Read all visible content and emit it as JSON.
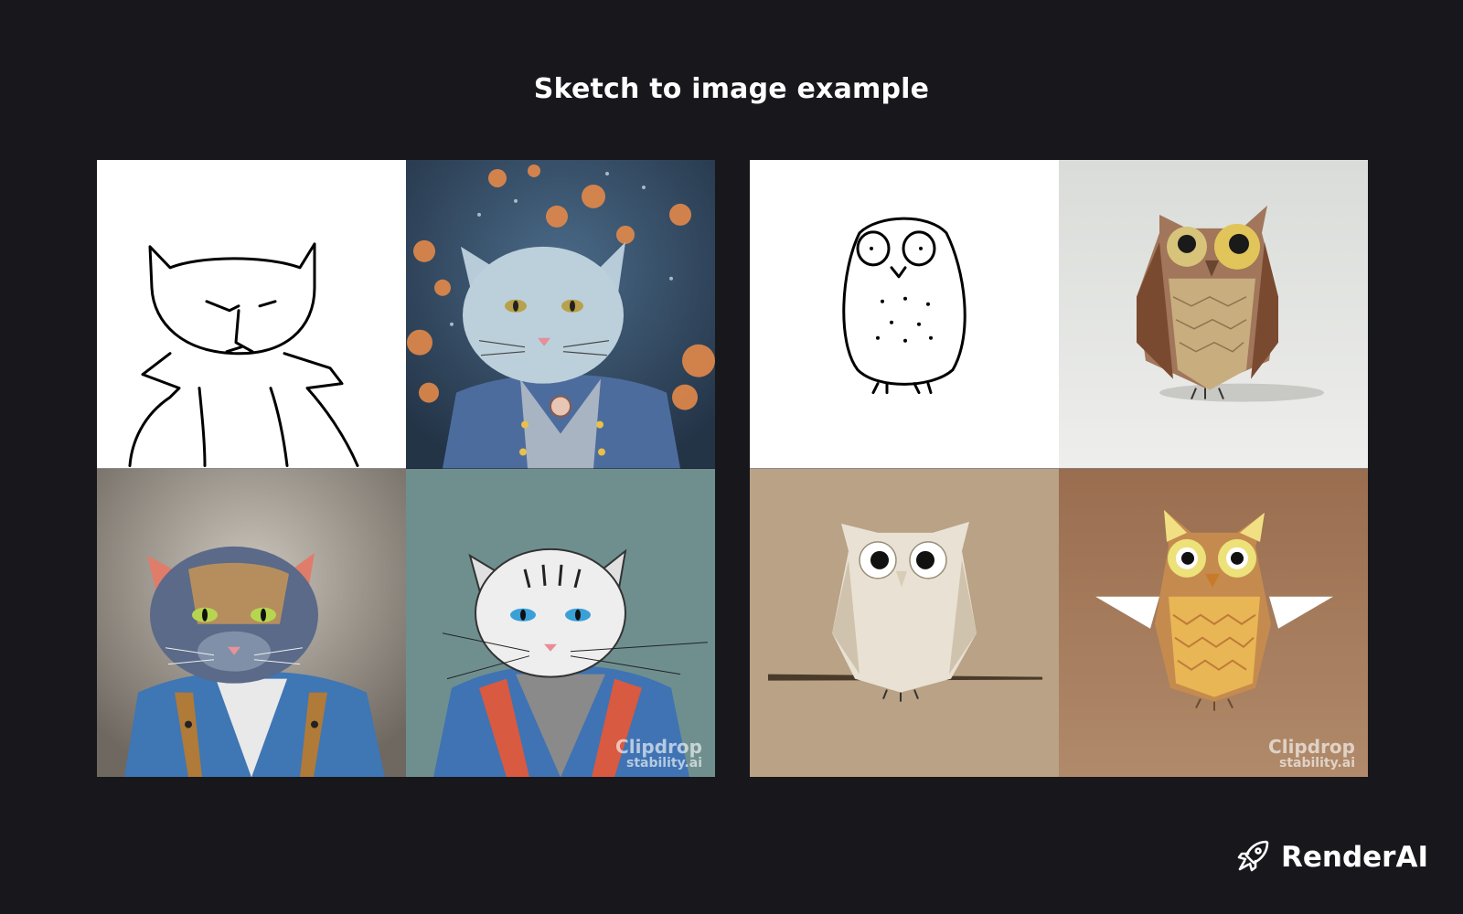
{
  "title": "Sketch to image example",
  "examples": [
    {
      "subject": "cat",
      "tiles": [
        "cat-sketch",
        "cat-jacket-painting-starry",
        "cat-jacket-painting-watercolor",
        "cat-jacket-illustration-teal"
      ],
      "watermark": {
        "brand": "Clipdrop",
        "sub": "stability.ai"
      }
    },
    {
      "subject": "owl",
      "tiles": [
        "owl-sketch",
        "origami-owl-brown",
        "origami-owl-white",
        "origami-owl-yellow"
      ],
      "watermark": {
        "brand": "Clipdrop",
        "sub": "stability.ai"
      }
    }
  ],
  "brand": {
    "name": "RenderAI",
    "icon": "rocket-icon"
  },
  "colors": {
    "background": "#17171c",
    "text": "#ffffff"
  }
}
